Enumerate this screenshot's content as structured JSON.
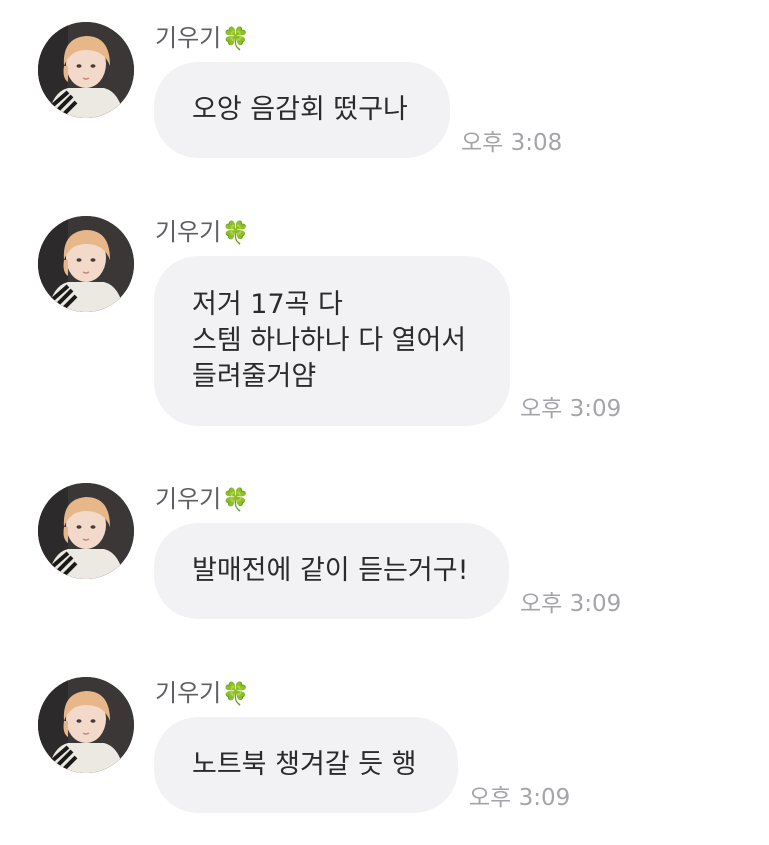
{
  "messages": [
    {
      "sender": "기우기",
      "sender_emoji": "🍀",
      "lines": [
        "오앙 음감회 떴구나"
      ],
      "time": "오후 3:08"
    },
    {
      "sender": "기우기",
      "sender_emoji": "🍀",
      "lines": [
        "저거 17곡 다",
        "스템 하나하나 다 열어서",
        "들려줄거얌"
      ],
      "time": "오후 3:09"
    },
    {
      "sender": "기우기",
      "sender_emoji": "🍀",
      "lines": [
        "발매전에 같이 듣는거구!"
      ],
      "time": "오후 3:09"
    },
    {
      "sender": "기우기",
      "sender_emoji": "🍀",
      "lines": [
        "노트북 챙겨갈 듯 행"
      ],
      "time": "오후 3:09"
    }
  ],
  "colors": {
    "bubble": "#f2f2f5",
    "text": "#2b2b2e",
    "sender": "#5e5e63",
    "time": "#a4a4a9"
  }
}
